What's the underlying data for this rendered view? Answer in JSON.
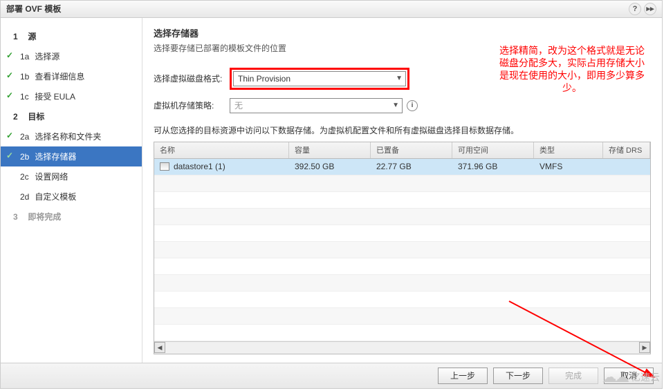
{
  "titlebar": {
    "title": "部署 OVF 模板",
    "help": "?",
    "collapse": "▸▸"
  },
  "sidebar": {
    "s1": {
      "num": "1",
      "label": "源"
    },
    "s1a": {
      "num": "1a",
      "label": "选择源"
    },
    "s1b": {
      "num": "1b",
      "label": "查看详细信息"
    },
    "s1c": {
      "num": "1c",
      "label": "接受 EULA"
    },
    "s2": {
      "num": "2",
      "label": "目标"
    },
    "s2a": {
      "num": "2a",
      "label": "选择名称和文件夹"
    },
    "s2b": {
      "num": "2b",
      "label": "选择存储器"
    },
    "s2c": {
      "num": "2c",
      "label": "设置网络"
    },
    "s2d": {
      "num": "2d",
      "label": "自定义模板"
    },
    "s3": {
      "num": "3",
      "label": "即将完成"
    }
  },
  "main": {
    "heading": "选择存储器",
    "subtitle": "选择要存储已部署的模板文件的位置",
    "disk_format_label": "选择虚拟磁盘格式:",
    "disk_format_value": "Thin Provision",
    "storage_policy_label": "虚拟机存储策略:",
    "storage_policy_value": "无",
    "instruction": "可从您选择的目标资源中访问以下数据存储。为虚拟机配置文件和所有虚拟磁盘选择目标数据存储。"
  },
  "table": {
    "headers": {
      "name": "名称",
      "capacity": "容量",
      "provisioned": "已置备",
      "free": "可用空间",
      "type": "类型",
      "drs": "存储 DRS"
    },
    "rows": [
      {
        "name": "datastore1 (1)",
        "capacity": "392.50 GB",
        "provisioned": "22.77 GB",
        "free": "371.96 GB",
        "type": "VMFS",
        "drs": ""
      }
    ]
  },
  "footer": {
    "back": "上一步",
    "next": "下一步",
    "finish": "完成",
    "cancel": "取消"
  },
  "annotation": "选择精简，改为这个格式就是无论磁盘分配多大，实际占用存储大小是现在使用的大小，即用多少算多少。",
  "watermark": "亿速云"
}
